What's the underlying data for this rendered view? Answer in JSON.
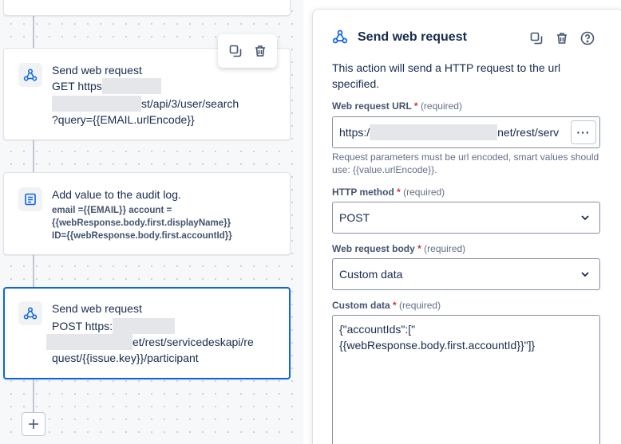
{
  "canvas": {
    "cards": [
      {
        "title": "Send web request",
        "line1_prefix": "GET https",
        "line2_suffix": "st/api/3/user/search",
        "line3": "?query={{EMAIL.urlEncode}}"
      },
      {
        "title": "Add value to the audit log.",
        "line1": "email ={{EMAIL}} account =",
        "line2": "{{webResponse.body.first.displayName}}",
        "line3": "ID={{webResponse.body.first.accountId}}"
      },
      {
        "title": "Send web request",
        "line1_prefix": "POST https:",
        "line2_suffix": "et/rest/servicedeskapi/re",
        "line3": "quest/{{issue.key}}/participant"
      }
    ],
    "add_label": "+"
  },
  "panel": {
    "title": "Send web request",
    "description": "This action will send a HTTP request to the url specified.",
    "url_label": "Web request URL",
    "url_prefix": "https:/",
    "url_suffix": "net/rest/serv",
    "required_text": "(required)",
    "help_text": "Request parameters must be url encoded, smart values should use: {{value.urlEncode}}.",
    "method_label": "HTTP method",
    "method_value": "POST",
    "body_label": "Web request body",
    "body_value": "Custom data",
    "custom_label": "Custom data",
    "custom_value": "{\"accountIds\":[\"\n{{webResponse.body.first.accountId}}\"]}",
    "more_label": "···"
  },
  "colors": {
    "accent": "#0c66e4",
    "required": "#c9372c"
  }
}
